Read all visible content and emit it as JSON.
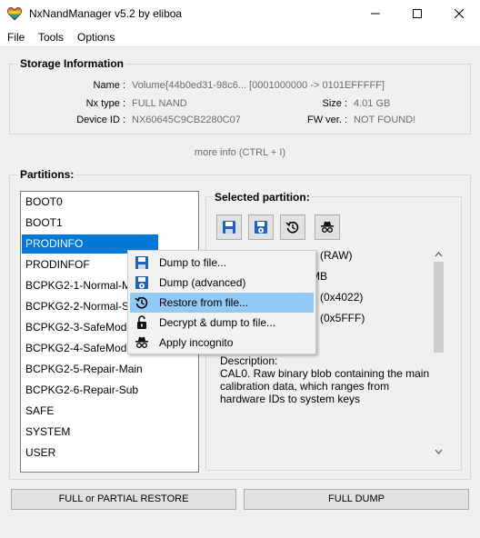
{
  "window": {
    "title": "NxNandManager v5.2 by eliboa",
    "app_icon": "heart-rainbow-icon",
    "controls": [
      "minimize-icon",
      "maximize-icon",
      "close-icon"
    ]
  },
  "menu": {
    "file": "File",
    "tools": "Tools",
    "options": "Options"
  },
  "storage": {
    "group_title": "Storage Information",
    "name_label": "Name :",
    "name_value": "Volume{44b0ed31-98c6... [0001000000 -> 0101EFFFFF]",
    "type_label": "Nx type :",
    "type_value": "FULL NAND",
    "size_label": "Size :",
    "size_value": "4.01 GB",
    "device_label": "Device ID :",
    "device_value": "NX60645C9CB2280C07",
    "fw_label": "FW ver. :",
    "fw_value": "NOT FOUND!",
    "more_info": "more info (CTRL + I)"
  },
  "partitions": {
    "group_title": "Partitions:",
    "items": [
      "BOOT0",
      "BOOT1",
      "PRODINFO",
      "PRODINFOF",
      "BCPKG2-1-Normal-M",
      "BCPKG2-2-Normal-Su",
      "BCPKG2-3-SafeMode-",
      "BCPKG2-4-SafeMode-",
      "BCPKG2-5-Repair-Main",
      "BCPKG2-6-Repair-Sub",
      "SAFE",
      "SYSTEM",
      "USER"
    ],
    "selected": "PRODINFO"
  },
  "selected_partition": {
    "title": "Selected partition:",
    "toolbar_icons": [
      "save-icon",
      "save-advanced-icon",
      "restore-icon",
      "incognito-icon"
    ],
    "info_lines": [
      "e (RAW)",
      "MB",
      "8 (0x4022)",
      "5 (0x5FFF)"
    ],
    "description_lines": [
      "Description:",
      "CAL0. Raw binary blob containing the main",
      "calibration data, which ranges from",
      "hardware IDs to system keys"
    ]
  },
  "context_menu": {
    "items": [
      {
        "label": "Dump to file...",
        "icon": "save-icon"
      },
      {
        "label": "Dump (advanced)",
        "icon": "save-advanced-icon"
      },
      {
        "label": "Restore from file...",
        "icon": "restore-icon"
      },
      {
        "label": "Decrypt & dump to file...",
        "icon": "unlock-icon"
      },
      {
        "label": "Apply incognito",
        "icon": "incognito-icon"
      }
    ],
    "highlighted": "Restore from file..."
  },
  "buttons": {
    "restore": "FULL or PARTIAL RESTORE",
    "dump": "FULL DUMP"
  }
}
